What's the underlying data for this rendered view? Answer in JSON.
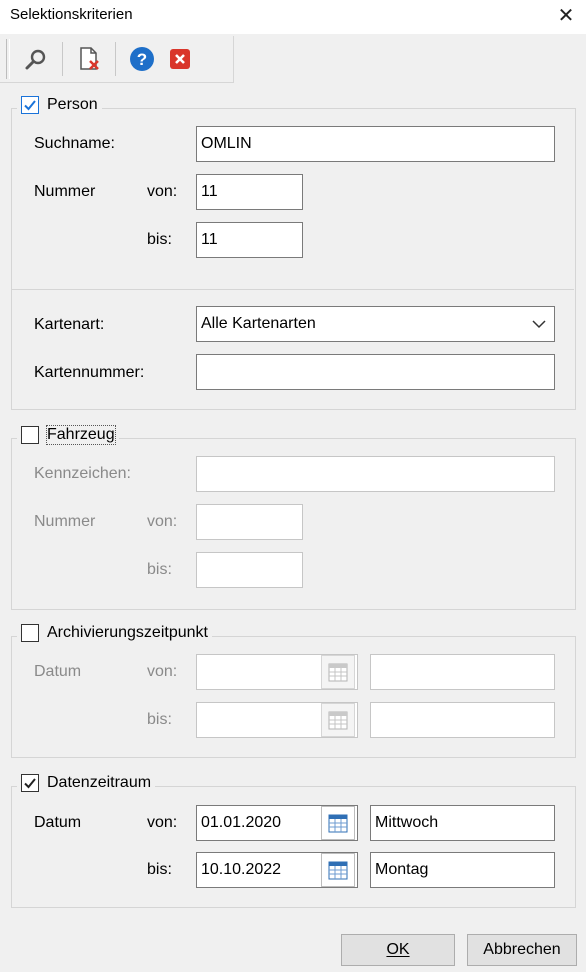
{
  "window": {
    "title": "Selektionskriterien"
  },
  "toolbar": {
    "icons": [
      "search-icon",
      "clear-filter-icon",
      "help-icon",
      "cancel-icon"
    ]
  },
  "person": {
    "legend": "Person",
    "checked": true,
    "suchname_label": "Suchname:",
    "suchname_value": "OMLIN",
    "nummer_label": "Nummer",
    "von_label": "von:",
    "nummer_von": "11",
    "bis_label": "bis:",
    "nummer_bis": "11",
    "kartenart_label": "Kartenart:",
    "kartenart_value": "Alle Kartenarten",
    "kartennummer_label": "Kartennummer:",
    "kartennummer_value": ""
  },
  "fahrzeug": {
    "legend": "Fahrzeug",
    "checked": false,
    "kennzeichen_label": "Kennzeichen:",
    "kennzeichen_value": "",
    "nummer_label": "Nummer",
    "von_label": "von:",
    "nummer_von": "",
    "bis_label": "bis:",
    "nummer_bis": ""
  },
  "archivierung": {
    "legend": "Archivierungszeitpunkt",
    "checked": false,
    "datum_label": "Datum",
    "von_label": "von:",
    "von_date": "",
    "von_day": "",
    "bis_label": "bis:",
    "bis_date": "",
    "bis_day": ""
  },
  "datenzeitraum": {
    "legend": "Datenzeitraum",
    "checked": true,
    "datum_label": "Datum",
    "von_label": "von:",
    "von_date": "01.01.2020",
    "von_day": "Mittwoch",
    "bis_label": "bis:",
    "bis_date": "10.10.2022",
    "bis_day": "Montag"
  },
  "buttons": {
    "ok_label": "OK",
    "cancel_label": "Abbrechen"
  },
  "colors": {
    "checkbox_blue": "#1a73d9",
    "help_blue": "#1e6fc9",
    "cancel_red": "#d9362b"
  }
}
